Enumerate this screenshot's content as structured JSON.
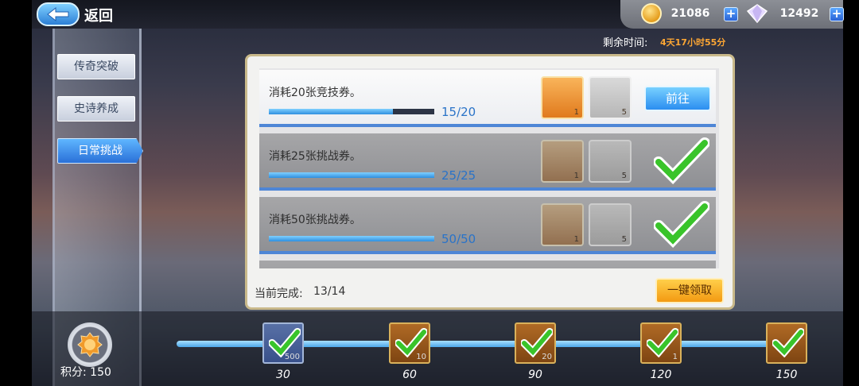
{
  "header": {
    "back_label": "返回",
    "coins": "21086",
    "gems": "12492"
  },
  "nav": {
    "items": [
      {
        "label": "传奇突破",
        "active": false
      },
      {
        "label": "史诗养成",
        "active": false
      },
      {
        "label": "日常挑战",
        "active": true
      }
    ]
  },
  "timer": {
    "label": "剩余时间:",
    "value": "4天17小时55分"
  },
  "tasks": [
    {
      "title": "消耗20张竞技券。",
      "progress": "15/20",
      "fraction": 0.75,
      "rewards": [
        {
          "icon": "scroll-icon",
          "count": "1"
        },
        {
          "icon": "medal-icon",
          "count": "5"
        }
      ],
      "action": "前往",
      "completed": false
    },
    {
      "title": "消耗25张挑战券。",
      "progress": "25/25",
      "fraction": 1.0,
      "rewards": [
        {
          "icon": "scroll-icon",
          "count": "1"
        },
        {
          "icon": "medal-icon",
          "count": "5"
        }
      ],
      "completed": true
    },
    {
      "title": "消耗50张挑战券。",
      "progress": "50/50",
      "fraction": 1.0,
      "rewards": [
        {
          "icon": "scroll-icon",
          "count": "1"
        },
        {
          "icon": "medal-icon",
          "count": "5"
        }
      ],
      "completed": true
    }
  ],
  "footer": {
    "current_label": "当前完成:",
    "current_value": "13/14",
    "claim_all": "一键领取"
  },
  "score": {
    "label": "积分: 150"
  },
  "milestones": [
    {
      "points": "30",
      "count": "500",
      "icon": "gem-pack-icon"
    },
    {
      "points": "60",
      "count": "10",
      "icon": "scroll-icon"
    },
    {
      "points": "90",
      "count": "20",
      "icon": "scroll-icon"
    },
    {
      "points": "120",
      "count": "1",
      "icon": "item-icon"
    },
    {
      "points": "150",
      "count": "",
      "icon": "character-icon"
    }
  ],
  "colors": {
    "accent_blue": "#2f8fe0",
    "timer_orange": "#ffa733",
    "check_green": "#39c42a",
    "claim_orange": "#f39a12"
  }
}
